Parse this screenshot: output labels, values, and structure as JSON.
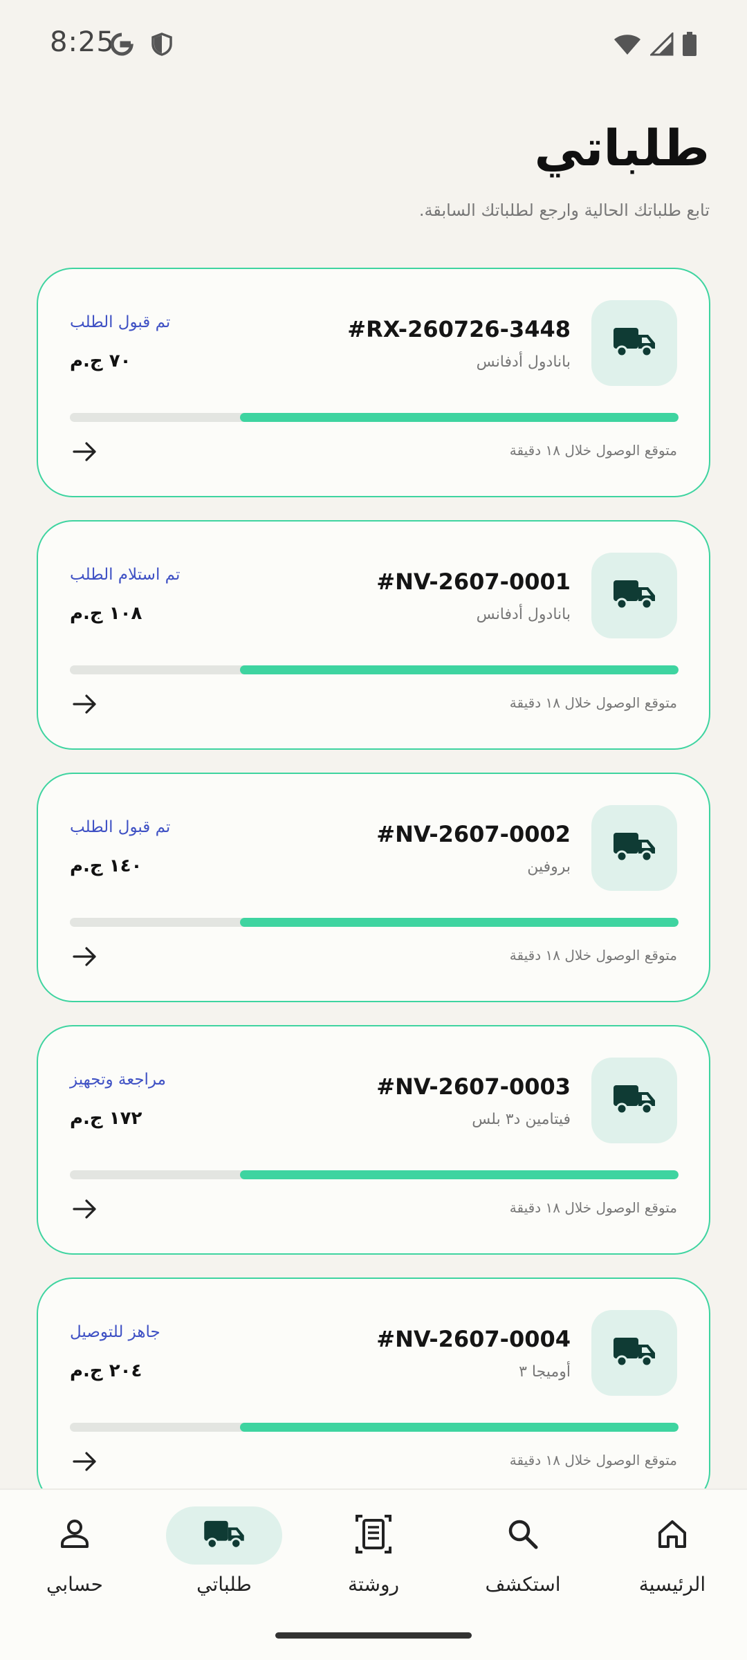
{
  "status_bar": {
    "time": "8:25",
    "left_icons": [
      "google-icon",
      "shield-icon"
    ],
    "right_icons": [
      "wifi-icon",
      "signal-icon",
      "battery-icon"
    ]
  },
  "header": {
    "title": "طلباتي",
    "subtitle": "تابع طلباتك الحالية وارجع لطلباتك السابقة."
  },
  "colors": {
    "accent": "#3ed4a0",
    "status_text": "#3f51c4",
    "icon_dark": "#0f3b34",
    "icon_bg": "#dff1eb"
  },
  "orders": [
    {
      "id": "#RX-260726-3448",
      "product": "بانادول أدفانس",
      "status": "تم قبول الطلب",
      "price": "٧٠ ج.م",
      "eta": "متوقع الوصول خلال ١٨ دقيقة",
      "progress": 0.72
    },
    {
      "id": "#NV-2607-0001",
      "product": "بانادول أدفانس",
      "status": "تم استلام الطلب",
      "price": "١٠٨ ج.م",
      "eta": "متوقع الوصول خلال ١٨ دقيقة",
      "progress": 0.72
    },
    {
      "id": "#NV-2607-0002",
      "product": "بروفين",
      "status": "تم قبول الطلب",
      "price": "١٤٠ ج.م",
      "eta": "متوقع الوصول خلال ١٨ دقيقة",
      "progress": 0.72
    },
    {
      "id": "#NV-2607-0003",
      "product": "فيتامين د٣ بلس",
      "status": "مراجعة وتجهيز",
      "price": "١٧٢ ج.م",
      "eta": "متوقع الوصول خلال ١٨ دقيقة",
      "progress": 0.72
    },
    {
      "id": "#NV-2607-0004",
      "product": "أوميجا ٣",
      "status": "جاهز للتوصيل",
      "price": "٢٠٤ ج.م",
      "eta": "متوقع الوصول خلال ١٨ دقيقة",
      "progress": 0.72
    }
  ],
  "bottom_nav": {
    "items": [
      {
        "key": "home",
        "label": "الرئيسية",
        "icon": "home-icon",
        "active": false
      },
      {
        "key": "explore",
        "label": "استكشف",
        "icon": "search-icon",
        "active": false
      },
      {
        "key": "prescription",
        "label": "روشتة",
        "icon": "document-icon",
        "active": false
      },
      {
        "key": "orders",
        "label": "طلباتي",
        "icon": "truck-icon",
        "active": true
      },
      {
        "key": "account",
        "label": "حسابي",
        "icon": "person-icon",
        "active": false
      }
    ]
  }
}
